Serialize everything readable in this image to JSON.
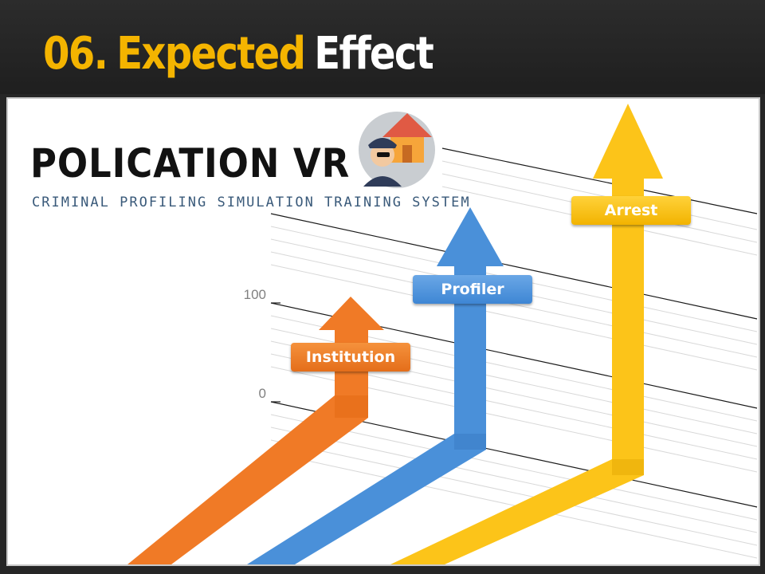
{
  "title": {
    "number": "06.",
    "expected": "Expected",
    "effect": "Effect"
  },
  "logo": {
    "name": "POLICATION VR",
    "tagline": "CRIMINAL PROFILING SIMULATION TRAINING SYSTEM",
    "emblem_icon": "police-house-icon"
  },
  "axis": {
    "tick_100": "100",
    "tick_0": "0"
  },
  "arrows": [
    {
      "label": "Institution",
      "color": "#f07a26"
    },
    {
      "label": "Profiler",
      "color": "#4a90d9"
    },
    {
      "label": "Arrest",
      "color": "#fcc419"
    }
  ],
  "colors": {
    "accent": "#f4b400",
    "header_bg": "#262626"
  }
}
